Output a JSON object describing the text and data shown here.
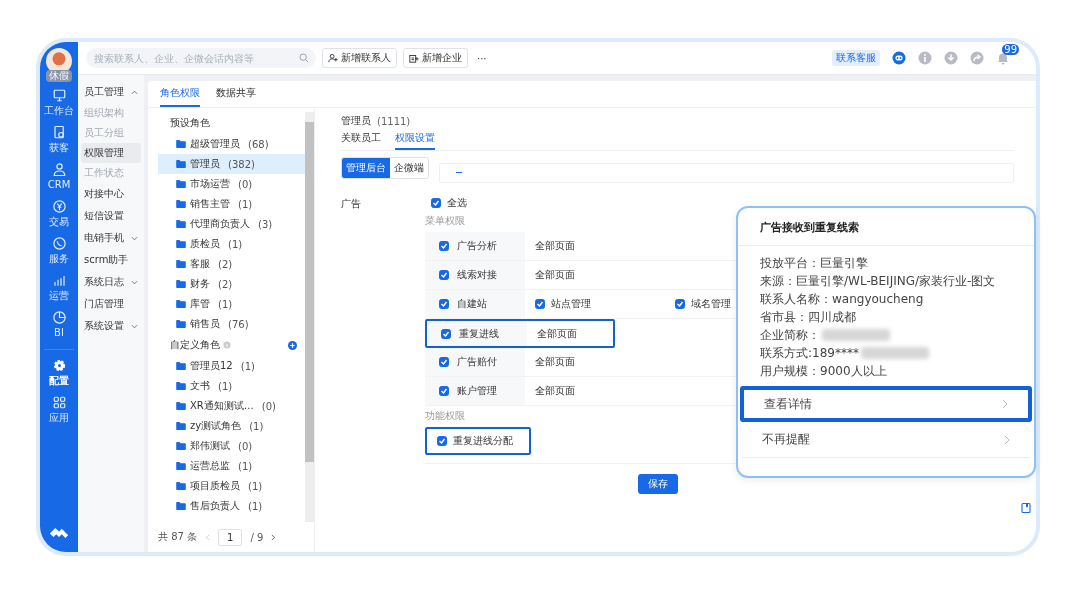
{
  "rail": {
    "avatar_badge": "休假",
    "items": [
      {
        "label": "工作台",
        "selected": false
      },
      {
        "label": "获客",
        "selected": false
      },
      {
        "label": "CRM",
        "selected": false
      },
      {
        "label": "交易",
        "selected": false
      },
      {
        "label": "服务",
        "selected": false
      },
      {
        "label": "运营",
        "selected": false
      },
      {
        "label": "BI",
        "selected": false
      },
      {
        "label": "配置",
        "selected": true
      },
      {
        "label": "应用",
        "selected": false
      }
    ]
  },
  "topbar": {
    "search": {
      "placeholder": "搜索联系人、企业、企微会话内容等"
    },
    "buttons": [
      {
        "label": "新增联系人"
      },
      {
        "label": "新增企业"
      }
    ],
    "more": "···",
    "service_tag": "联系客服",
    "notification_count": "99"
  },
  "subnav": [
    {
      "label": "员工管理",
      "expanded": true,
      "children": [
        {
          "label": "组织架构",
          "selected": false
        },
        {
          "label": "员工分组",
          "selected": false
        },
        {
          "label": "权限管理",
          "selected": true
        },
        {
          "label": "工作状态",
          "selected": false
        }
      ]
    },
    {
      "label": "对接中心"
    },
    {
      "label": "短信设置"
    },
    {
      "label": "电销手机",
      "expanded": false
    },
    {
      "label": "scrm助手"
    },
    {
      "label": "系统日志",
      "expanded": false
    },
    {
      "label": "门店管理"
    },
    {
      "label": "系统设置",
      "expanded": false
    }
  ],
  "tabs": [
    {
      "label": "角色权限",
      "selected": true
    },
    {
      "label": "数据共享",
      "selected": false
    }
  ],
  "roles": {
    "groups": [
      {
        "title": "预设角色",
        "children": [
          {
            "name": "超级管理员",
            "count": "(68)",
            "selected": false
          },
          {
            "name": "管理员",
            "count": "(382)",
            "selected": true
          },
          {
            "name": "市场运营",
            "count": "(0)",
            "selected": false
          },
          {
            "name": "销售主管",
            "count": "(1)",
            "selected": false
          },
          {
            "name": "代理商负责人",
            "count": "(3)",
            "selected": false
          },
          {
            "name": "质检员",
            "count": "(1)",
            "selected": false
          },
          {
            "name": "客服",
            "count": "(2)",
            "selected": false
          },
          {
            "name": "财务",
            "count": "(2)",
            "selected": false
          },
          {
            "name": "库管",
            "count": "(1)",
            "selected": false
          },
          {
            "name": "销售员",
            "count": "(76)",
            "selected": false
          }
        ]
      },
      {
        "title": "自定义角色",
        "children": [
          {
            "name": "管理员12",
            "count": "(1)",
            "selected": false
          },
          {
            "name": "文书",
            "count": "(1)",
            "selected": false
          },
          {
            "name": "XR通知测试…",
            "count": "(0)",
            "selected": false
          },
          {
            "name": "zy测试角色",
            "count": "(1)",
            "selected": false
          },
          {
            "name": "郑伟测试",
            "count": "(0)",
            "selected": false
          },
          {
            "name": "运营总监",
            "count": "(1)",
            "selected": false
          },
          {
            "name": "项目质检员",
            "count": "(1)",
            "selected": false
          },
          {
            "name": "售后负责人",
            "count": "(1)",
            "selected": false
          }
        ]
      }
    ],
    "pagination": {
      "total": "共 87 条",
      "page": "1",
      "pages": "/ 9"
    }
  },
  "detail": {
    "role": "管理员",
    "role_code": "(1111)",
    "tabs": [
      {
        "label": "关联员工",
        "selected": false
      },
      {
        "label": "权限设置",
        "selected": true
      }
    ],
    "segments": [
      {
        "label": "管理后台",
        "selected": true
      },
      {
        "label": "企微端",
        "selected": false
      }
    ],
    "section": {
      "title": "广告",
      "select_all": {
        "label": "全选",
        "checked": true
      },
      "menu_title": "菜单权限",
      "rows": [
        {
          "kind": "page",
          "label": "广告分析",
          "checked": true,
          "value": "全部页面",
          "highlighted": false
        },
        {
          "kind": "page",
          "label": "线索对接",
          "checked": true,
          "value": "全部页面",
          "highlighted": false
        },
        {
          "kind": "sub",
          "label": "自建站",
          "checked": true,
          "highlighted": false,
          "subs": [
            {
              "label": "站点管理",
              "checked": true
            },
            {
              "label": "域名管理",
              "checked": true
            }
          ]
        },
        {
          "kind": "page",
          "label": "重复进线",
          "checked": true,
          "value": "全部页面",
          "highlighted": true
        },
        {
          "kind": "page",
          "label": "广告赔付",
          "checked": true,
          "value": "全部页面",
          "highlighted": false
        },
        {
          "kind": "page",
          "label": "账户管理",
          "checked": true,
          "value": "全部页面",
          "highlighted": false
        }
      ],
      "function_title": "功能权限",
      "functions": [
        {
          "label": "重复进线分配",
          "checked": true,
          "highlighted": true
        }
      ]
    },
    "save": "保存"
  },
  "popup": {
    "title": "广告接收到重复线索",
    "lines": [
      {
        "text": "投放平台：巨量引擎",
        "redacted": false
      },
      {
        "text": "来源：巨量引擎/WL-BEIJING/家装行业-图文",
        "redacted": false
      },
      {
        "text": "联系人名称：wangyoucheng",
        "redacted": false
      },
      {
        "text": "省市县：四川成都",
        "redacted": false
      },
      {
        "text": "企业简称：",
        "redacted": true
      },
      {
        "text": "联系方式:189****",
        "redacted": true
      },
      {
        "text": "用户规模：9000人以上",
        "redacted": false
      }
    ],
    "actions": [
      {
        "label": "查看详情",
        "highlighted": true
      },
      {
        "label": "不再提醒",
        "highlighted": false
      }
    ]
  }
}
